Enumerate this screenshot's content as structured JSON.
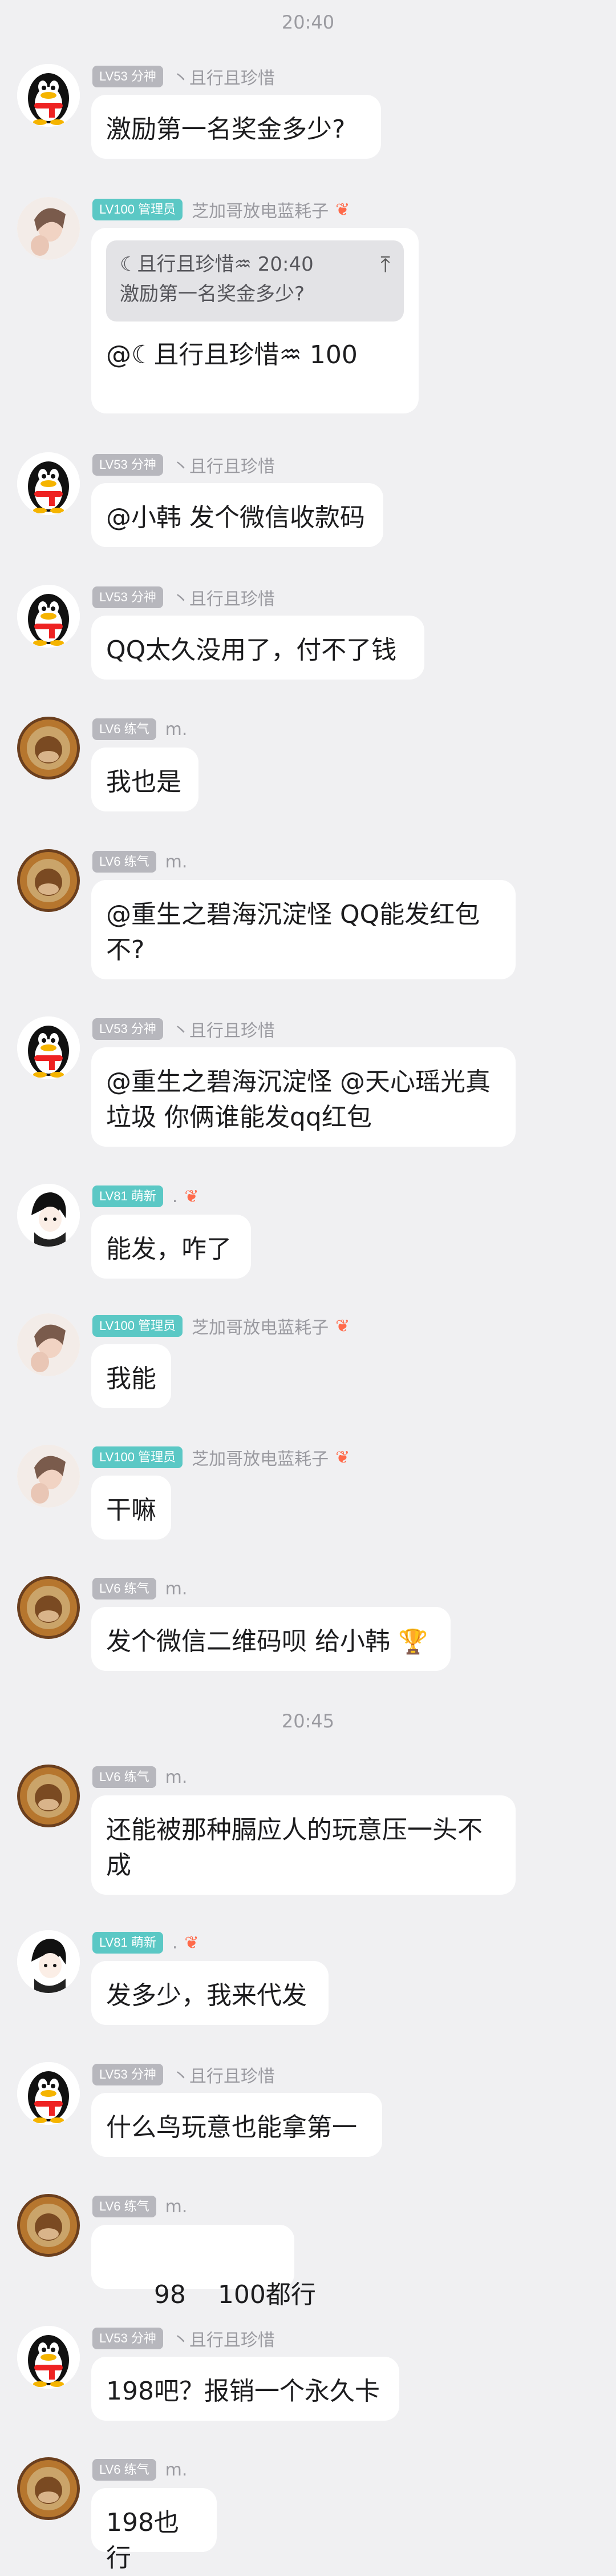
{
  "timestamps": [
    "20:40",
    "20:45"
  ],
  "messages": [
    {
      "badge": "LV53 分神",
      "nick": "丶且行且珍惜",
      "text": "激励第一名奖金多少?"
    },
    {
      "badge": "LV100 管理员",
      "nick": "芝加哥放电蓝耗子",
      "flame": true,
      "quote": {
        "author": "☾且行且珍惜♒︎ 20:40",
        "text": "激励第一名奖金多少?"
      },
      "text": "@☾且行且珍惜♒︎ 100"
    },
    {
      "badge": "LV53 分神",
      "nick": "丶且行且珍惜",
      "text": "@小韩 发个微信收款码"
    },
    {
      "badge": "LV53 分神",
      "nick": "丶且行且珍惜",
      "text": "QQ太久没用了，付不了钱"
    },
    {
      "badge": "LV6 练气",
      "nick": "m.",
      "text": "我也是"
    },
    {
      "badge": "LV6 练气",
      "nick": "m.",
      "text_lines": [
        "@重生之碧海沉淀怪 QQ能发红包",
        "不?"
      ]
    },
    {
      "badge": "LV53 分神",
      "nick": "丶且行且珍惜",
      "text_lines": [
        "@重生之碧海沉淀怪 @天心瑶光真",
        "垃圾 你俩谁能发qq红包"
      ]
    },
    {
      "badge": "LV81 萌新",
      "nick": ".",
      "flame": true,
      "text": "能发，咋了"
    },
    {
      "badge": "LV100 管理员",
      "nick": "芝加哥放电蓝耗子",
      "flame": true,
      "text": "我能"
    },
    {
      "badge": "LV100 管理员",
      "nick": "芝加哥放电蓝耗子",
      "flame": true,
      "text": "干嘛"
    },
    {
      "badge": "LV6 练气",
      "nick": "m.",
      "text": "发个微信二维码呗  给小韩",
      "trophy": "🏆"
    },
    {
      "badge": "LV6 练气",
      "nick": "m.",
      "text_lines": [
        "还能被那种膈应人的玩意压一头不",
        "成"
      ]
    },
    {
      "badge": "LV81 萌新",
      "nick": ".",
      "flame": true,
      "text": "发多少，我来代发"
    },
    {
      "badge": "LV53 分神",
      "nick": "丶且行且珍惜",
      "text": "什么鸟玩意也能拿第一"
    },
    {
      "badge": "LV6 练气",
      "nick": "m.",
      "text": "  98    100都行"
    },
    {
      "badge": "LV53 分神",
      "nick": "丶且行且珍惜",
      "text": "198吧？报销一个永久卡"
    },
    {
      "badge": "LV6 练气",
      "nick": "m.",
      "text": "198也行"
    }
  ],
  "icons": {
    "avatar_qq": "penguin-avatar",
    "avatar_m": "straw-hat-avatar",
    "avatar_admin": "girl-avatar",
    "avatar_dot": "anime-avatar",
    "flame": "flame-icon",
    "quote_arrow": "jump-to-top-icon"
  }
}
